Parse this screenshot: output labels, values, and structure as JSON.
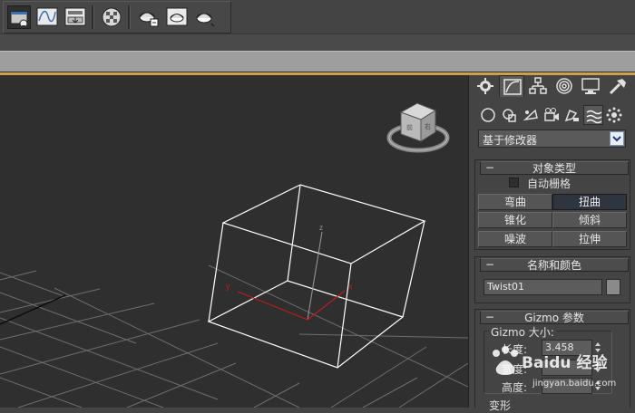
{
  "toolbar": {
    "buttons": [
      {
        "icon": "scene-explorer-icon",
        "active": true
      },
      {
        "icon": "curve-editor-icon"
      },
      {
        "icon": "schematic-view-icon"
      },
      {
        "icon": "material-editor-icon"
      },
      {
        "icon": "render-setup-icon"
      },
      {
        "icon": "rendered-frame-window-icon"
      },
      {
        "icon": "render-production-icon"
      }
    ]
  },
  "viewport": {
    "gizmo_axes": {
      "x": "x",
      "y": "y",
      "z": "z"
    },
    "colors": {
      "grid": "#6e6e6e",
      "gizmo": "#ffffff",
      "x_axis": "#c21a1a",
      "y_axis": "#c21a1a",
      "z_axis": "#9a9a9a"
    }
  },
  "command_panel": {
    "tabs": [
      "create-icon",
      "modify-icon",
      "hierarchy-icon",
      "motion-icon",
      "display-icon",
      "utilities-icon"
    ],
    "subtabs": [
      "geometry-icon",
      "shapes-icon",
      "lights-icon",
      "cameras-icon",
      "helpers-icon",
      "space-warps-icon",
      "systems-icon"
    ],
    "dropdown": {
      "value": "基于修改器"
    },
    "object_type": {
      "title": "对象类型",
      "autogrid_label": "自动栅格",
      "buttons": [
        "弯曲",
        "扭曲",
        "锥化",
        "倾斜",
        "噪波",
        "拉伸"
      ],
      "selected": "扭曲"
    },
    "name_color": {
      "title": "名称和颜色",
      "name_value": "Twist01"
    },
    "gizmo_params": {
      "title": "Gizmo 参数",
      "group_label": "Gizmo 大小:",
      "length_label": "长度:",
      "length_value": "3.458",
      "width_label": "宽度:",
      "height_label": "高度:",
      "next_label": "变形"
    },
    "watermark": "Baidu 经验",
    "watermark_sub": "jingyan.baidu.com"
  }
}
